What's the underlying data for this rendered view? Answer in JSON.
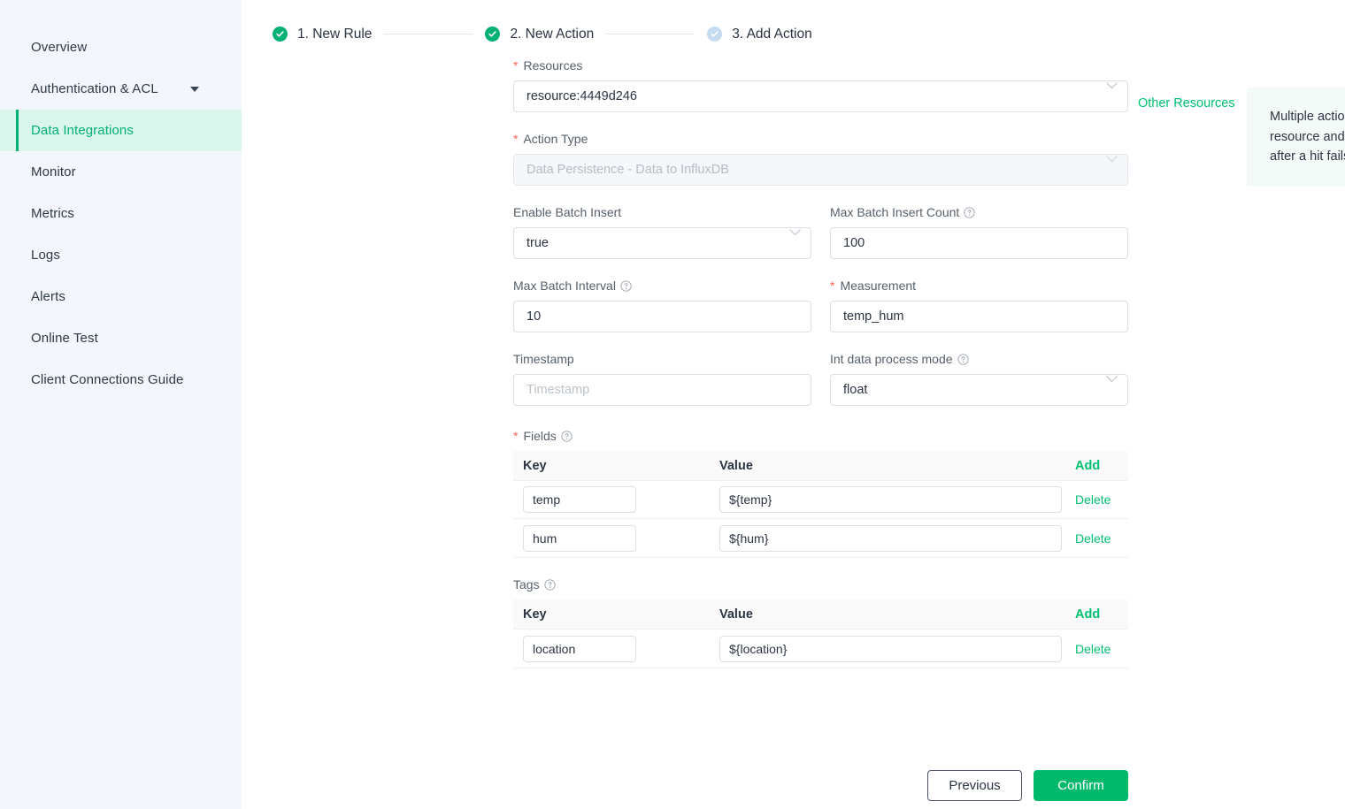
{
  "sidebar": {
    "items": [
      {
        "label": "Overview",
        "active": false,
        "caret": false
      },
      {
        "label": "Authentication & ACL",
        "active": false,
        "caret": true
      },
      {
        "label": "Data Integrations",
        "active": true,
        "caret": false
      },
      {
        "label": "Monitor",
        "active": false,
        "caret": false
      },
      {
        "label": "Metrics",
        "active": false,
        "caret": false
      },
      {
        "label": "Logs",
        "active": false,
        "caret": false
      },
      {
        "label": "Alerts",
        "active": false,
        "caret": false
      },
      {
        "label": "Online Test",
        "active": false,
        "caret": false
      },
      {
        "label": "Client Connections Guide",
        "active": false,
        "caret": false
      }
    ]
  },
  "steps": [
    {
      "label": "1. New Rule",
      "state": "done"
    },
    {
      "label": "2. New Action",
      "state": "done"
    },
    {
      "label": "3. Add Action",
      "state": "todo"
    }
  ],
  "form": {
    "resources": {
      "label": "Resources",
      "required": true,
      "value": "resource:4449d246"
    },
    "other_resources_link": "Other Resources",
    "action_type": {
      "label": "Action Type",
      "required": true,
      "value": "Data Persistence - Data to InfluxDB",
      "disabled": true
    },
    "enable_batch_insert": {
      "label": "Enable Batch Insert",
      "value": "true"
    },
    "max_batch_insert_count": {
      "label": "Max Batch Insert Count",
      "value": "100",
      "help": true
    },
    "max_batch_interval": {
      "label": "Max Batch Interval",
      "value": "10",
      "help": true
    },
    "measurement": {
      "label": "Measurement",
      "required": true,
      "value": "temp_hum"
    },
    "timestamp": {
      "label": "Timestamp",
      "value": "",
      "placeholder": "Timestamp"
    },
    "int_data_process_mode": {
      "label": "Int data process mode",
      "value": "float",
      "help": true
    }
  },
  "fields_table": {
    "label": "Fields",
    "required": true,
    "help": true,
    "columns": {
      "key": "Key",
      "value": "Value",
      "action": "Add"
    },
    "row_action": "Delete",
    "rows": [
      {
        "key": "temp",
        "value": "${temp}"
      },
      {
        "key": "hum",
        "value": "${hum}"
      }
    ]
  },
  "tags_table": {
    "label": "Tags",
    "required": false,
    "help": true,
    "columns": {
      "key": "Key",
      "value": "Value",
      "action": "Add"
    },
    "row_action": "Delete",
    "rows": [
      {
        "key": "location",
        "value": "${location}"
      }
    ]
  },
  "tip": {
    "text": "Multiple actions can be added to the same resource and associated actions can be added after a hit fails."
  },
  "footer": {
    "previous": "Previous",
    "confirm": "Confirm"
  },
  "colors": {
    "accent_green": "#00b173",
    "link_green": "#00c070",
    "confirm_green": "#00b96b",
    "required_red": "#f5634a",
    "sidebar_bg": "#f3f6fc",
    "active_bg": "#d9f5ec",
    "step_todo": "#c5dbf0"
  }
}
